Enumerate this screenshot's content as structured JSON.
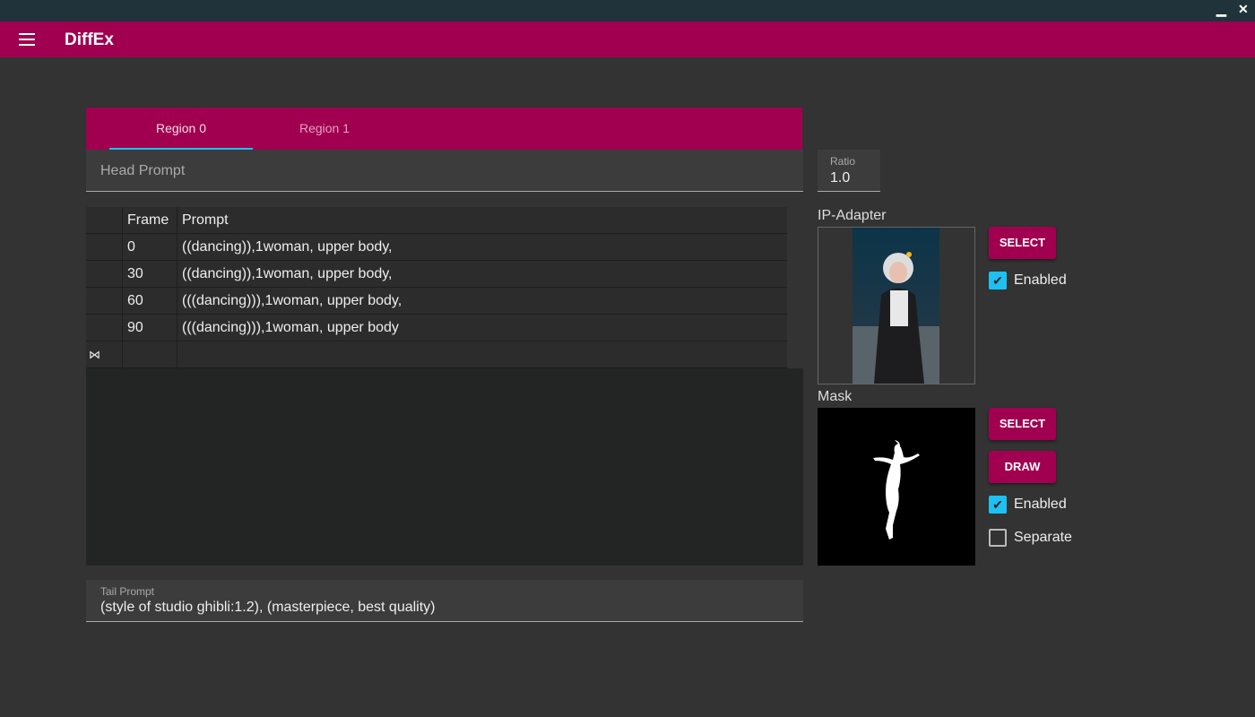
{
  "window": {
    "minimize": "▁",
    "close": "✕"
  },
  "app": {
    "title": "DiffEx"
  },
  "tabs": [
    {
      "label": "Region 0"
    },
    {
      "label": "Region 1"
    }
  ],
  "head_prompt": {
    "placeholder": "Head Prompt"
  },
  "table": {
    "headers": [
      "Frame",
      "Prompt"
    ],
    "rows": [
      {
        "frame": "0",
        "prompt": "((dancing)),1woman, upper body,"
      },
      {
        "frame": "30",
        "prompt": "((dancing)),1woman, upper body,"
      },
      {
        "frame": "60",
        "prompt": "(((dancing))),1woman, upper body,"
      },
      {
        "frame": "90",
        "prompt": "(((dancing))),1woman, upper body"
      }
    ],
    "new_row_icon": "⋈"
  },
  "tail_prompt": {
    "label": "Tail Prompt",
    "value": "(style of studio ghibli:1.2), (masterpiece, best quality)"
  },
  "ratio": {
    "label": "Ratio",
    "value": "1.0"
  },
  "ip_adapter": {
    "label": "IP-Adapter",
    "select": "SELECT",
    "enabled": "Enabled"
  },
  "mask": {
    "label": "Mask",
    "select": "SELECT",
    "draw": "DRAW",
    "enabled": "Enabled",
    "separate": "Separate"
  },
  "colors": {
    "accent": "#a0004f",
    "check": "#1ec0f0"
  }
}
